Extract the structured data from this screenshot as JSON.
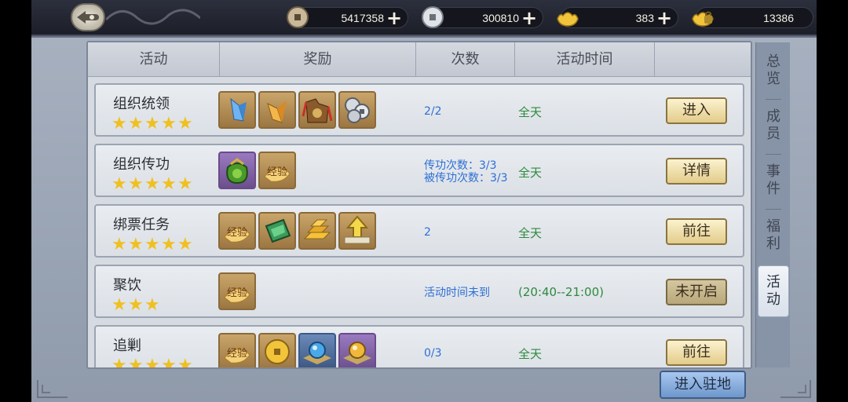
{
  "currencies": [
    {
      "icon": "copper-coin-icon",
      "value": "5417358",
      "plus": true
    },
    {
      "icon": "silver-coin-icon",
      "value": "300810",
      "plus": true
    },
    {
      "icon": "gold-ingot-icon",
      "value": "383",
      "plus": true
    },
    {
      "icon": "locked-gold-icon",
      "value": "13386",
      "plus": false
    }
  ],
  "table": {
    "headers": [
      "活动",
      "奖励",
      "次数",
      "活动时间",
      ""
    ],
    "rows": [
      {
        "name": "组织统领",
        "stars": 5,
        "rewards": [
          "blue-crystal-icon",
          "gold-crystal-icon",
          "pouch-icon",
          "silver-coins-icon"
        ],
        "count": [
          "2/2"
        ],
        "time": "全天",
        "button": "进入",
        "disabled": false
      },
      {
        "name": "组织传功",
        "stars": 5,
        "rewards": [
          "gift-bag-icon",
          "exp-icon"
        ],
        "count": [
          "传功次数：3/3",
          "被传功次数：3/3"
        ],
        "time": "全天",
        "button": "详情",
        "disabled": false
      },
      {
        "name": "绑票任务",
        "stars": 5,
        "rewards": [
          "exp-icon",
          "jade-icon",
          "gold-bars-icon",
          "upgrade-arrow-icon"
        ],
        "count": [
          "2"
        ],
        "time": "全天",
        "button": "前往",
        "disabled": false
      },
      {
        "name": "聚饮",
        "stars": 3,
        "rewards": [
          "exp-icon"
        ],
        "count": [
          "活动时间未到"
        ],
        "time": "(20:40--21:00)",
        "button": "未开启",
        "disabled": true
      },
      {
        "name": "追剿",
        "stars": 5,
        "rewards": [
          "exp-icon",
          "gold-coin-icon",
          "blue-orb-icon",
          "gold-orb-icon"
        ],
        "count": [
          "0/3"
        ],
        "time": "全天",
        "button": "前往",
        "disabled": false
      }
    ]
  },
  "tabs": [
    {
      "label": "总览",
      "active": false
    },
    {
      "label": "成员",
      "active": false
    },
    {
      "label": "事件",
      "active": false
    },
    {
      "label": "福利",
      "active": false
    },
    {
      "label": "活动",
      "active": true
    }
  ],
  "enter_button": "进入驻地",
  "colors": {
    "count_blue": "#2e6fd4",
    "time_green": "#2d8a3c",
    "star_gold": "#f0c020"
  }
}
